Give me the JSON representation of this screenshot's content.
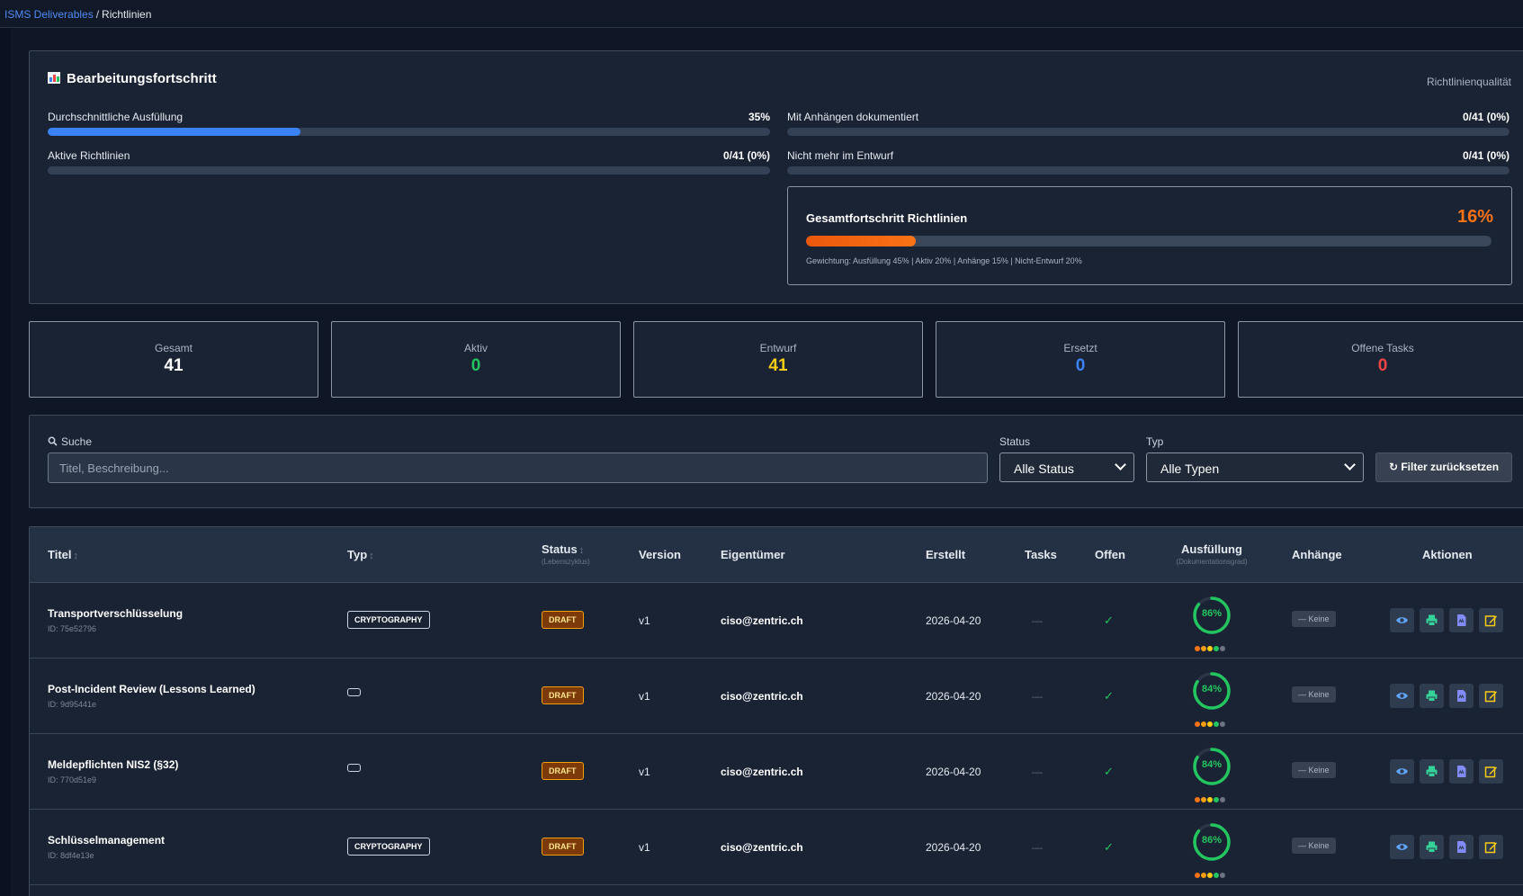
{
  "breadcrumb": {
    "root": "ISMS Deliverables",
    "separator": "/",
    "current": "Richtlinien"
  },
  "progress": {
    "title": "Bearbeitungsfortschritt",
    "right_label": "Richtlinienqualität",
    "metrics": [
      {
        "label": "Durchschnittliche Ausfüllung",
        "value": "35%",
        "fraction": 0.35
      },
      {
        "label": "Mit Anhängen dokumentiert",
        "value": "0/41 (0%)",
        "fraction": 0
      },
      {
        "label": "Aktive Richtlinien",
        "value": "0/41 (0%)",
        "fraction": 0
      },
      {
        "label": "Nicht mehr im Entwurf",
        "value": "0/41 (0%)",
        "fraction": 0
      }
    ],
    "overall": {
      "title": "Gesamtfortschritt Richtlinien",
      "percent": "16%",
      "fraction": 0.16,
      "weighting": "Gewichtung: Ausfüllung 45% | Aktiv 20% | Anhänge 15% | Nicht-Entwurf 20%"
    }
  },
  "stats": [
    {
      "label": "Gesamt",
      "value": "41",
      "color": "#ffffff"
    },
    {
      "label": "Aktiv",
      "value": "0",
      "color": "#22c55e"
    },
    {
      "label": "Entwurf",
      "value": "41",
      "color": "#facc15"
    },
    {
      "label": "Ersetzt",
      "value": "0",
      "color": "#3b82f6"
    },
    {
      "label": "Offene Tasks",
      "value": "0",
      "color": "#ef4444"
    }
  ],
  "filters": {
    "search_label": "Suche",
    "search_placeholder": "Titel, Beschreibung...",
    "status_label": "Status",
    "status_value": "Alle Status",
    "type_label": "Typ",
    "type_value": "Alle Typen",
    "reset_label": "↻ Filter zurücksetzen"
  },
  "table": {
    "headers": {
      "title": "Titel",
      "type": "Typ",
      "status": "Status",
      "status_sub": "(Lebenszyklus)",
      "version": "Version",
      "owner": "Eigentümer",
      "created": "Erstellt",
      "tasks": "Tasks",
      "open": "Offen",
      "fill": "Ausfüllung",
      "fill_sub": "(Dokumentationsgrad)",
      "attachments": "Anhänge",
      "actions": "Aktionen"
    },
    "sort_glyph": "↕",
    "rows": [
      {
        "title": "Transportverschlüsselung",
        "id": "ID: 75e52796",
        "type": "CRYPTOGRAPHY",
        "status": "DRAFT",
        "version": "v1",
        "owner": "ciso@zentric.ch",
        "created": "2026-04-20",
        "tasks": "—",
        "open": "✓",
        "fill": "86%",
        "fill_fraction": 0.86,
        "dots": [
          "#f97316",
          "#f59e0b",
          "#facc15",
          "#22c55e",
          "#6b7280"
        ],
        "attachments": "— Keine"
      },
      {
        "title": "Post-Incident Review (Lessons Learned)",
        "id": "ID: 9d95441e",
        "type": "",
        "status": "DRAFT",
        "version": "v1",
        "owner": "ciso@zentric.ch",
        "created": "2026-04-20",
        "tasks": "—",
        "open": "✓",
        "fill": "84%",
        "fill_fraction": 0.84,
        "dots": [
          "#f97316",
          "#f59e0b",
          "#facc15",
          "#22c55e",
          "#6b7280"
        ],
        "attachments": "— Keine"
      },
      {
        "title": "Meldepflichten NIS2 (§32)",
        "id": "ID: 770d51e9",
        "type": "",
        "status": "DRAFT",
        "version": "v1",
        "owner": "ciso@zentric.ch",
        "created": "2026-04-20",
        "tasks": "—",
        "open": "✓",
        "fill": "84%",
        "fill_fraction": 0.84,
        "dots": [
          "#f97316",
          "#f59e0b",
          "#facc15",
          "#22c55e",
          "#6b7280"
        ],
        "attachments": "— Keine"
      },
      {
        "title": "Schlüsselmanagement",
        "id": "ID: 8df4e13e",
        "type": "CRYPTOGRAPHY",
        "status": "DRAFT",
        "version": "v1",
        "owner": "ciso@zentric.ch",
        "created": "2026-04-20",
        "tasks": "—",
        "open": "✓",
        "fill": "86%",
        "fill_fraction": 0.86,
        "dots": [
          "#f97316",
          "#f59e0b",
          "#facc15",
          "#22c55e",
          "#6b7280"
        ],
        "attachments": "— Keine"
      }
    ],
    "action_icons": [
      "eye-icon",
      "printer-icon",
      "pdf-file-icon",
      "edit-icon"
    ],
    "action_colors": [
      "#60a5fa",
      "#34d399",
      "#818cf8",
      "#facc15"
    ]
  }
}
